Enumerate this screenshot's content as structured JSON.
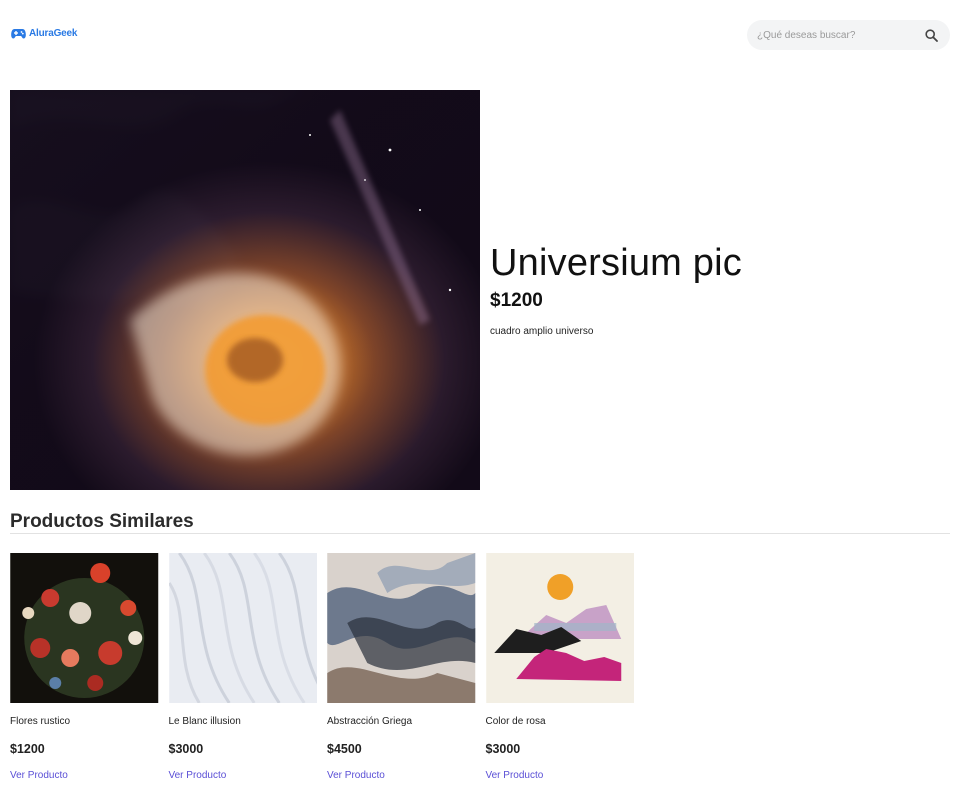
{
  "brand": {
    "logo_part1": "Alura",
    "logo_part2": "Geek",
    "accent_color": "#2a7ae4"
  },
  "search": {
    "placeholder": "¿Qué deseas buscar?",
    "value": "",
    "icon": "search-icon"
  },
  "hero": {
    "title": "Universium pic",
    "price": "$1200",
    "description": "cuadro amplio universo",
    "image": "cosmic-nebula-painting"
  },
  "similar": {
    "title": "Productos Similares",
    "products": [
      {
        "name": "Flores rustico",
        "price": "$1200",
        "link": "Ver Producto",
        "image": "floral-still-life"
      },
      {
        "name": "Le Blanc illusion",
        "price": "$3000",
        "link": "Ver Producto",
        "image": "white-waves"
      },
      {
        "name": "Abstracción Griega",
        "price": "$4500",
        "link": "Ver Producto",
        "image": "abstract-marble"
      },
      {
        "name": "Color de rosa",
        "price": "$3000",
        "link": "Ver Producto",
        "image": "pink-mountains-sun"
      }
    ]
  },
  "colors": {
    "link": "#5a4fd6",
    "search_bg": "#f3f4f5"
  }
}
